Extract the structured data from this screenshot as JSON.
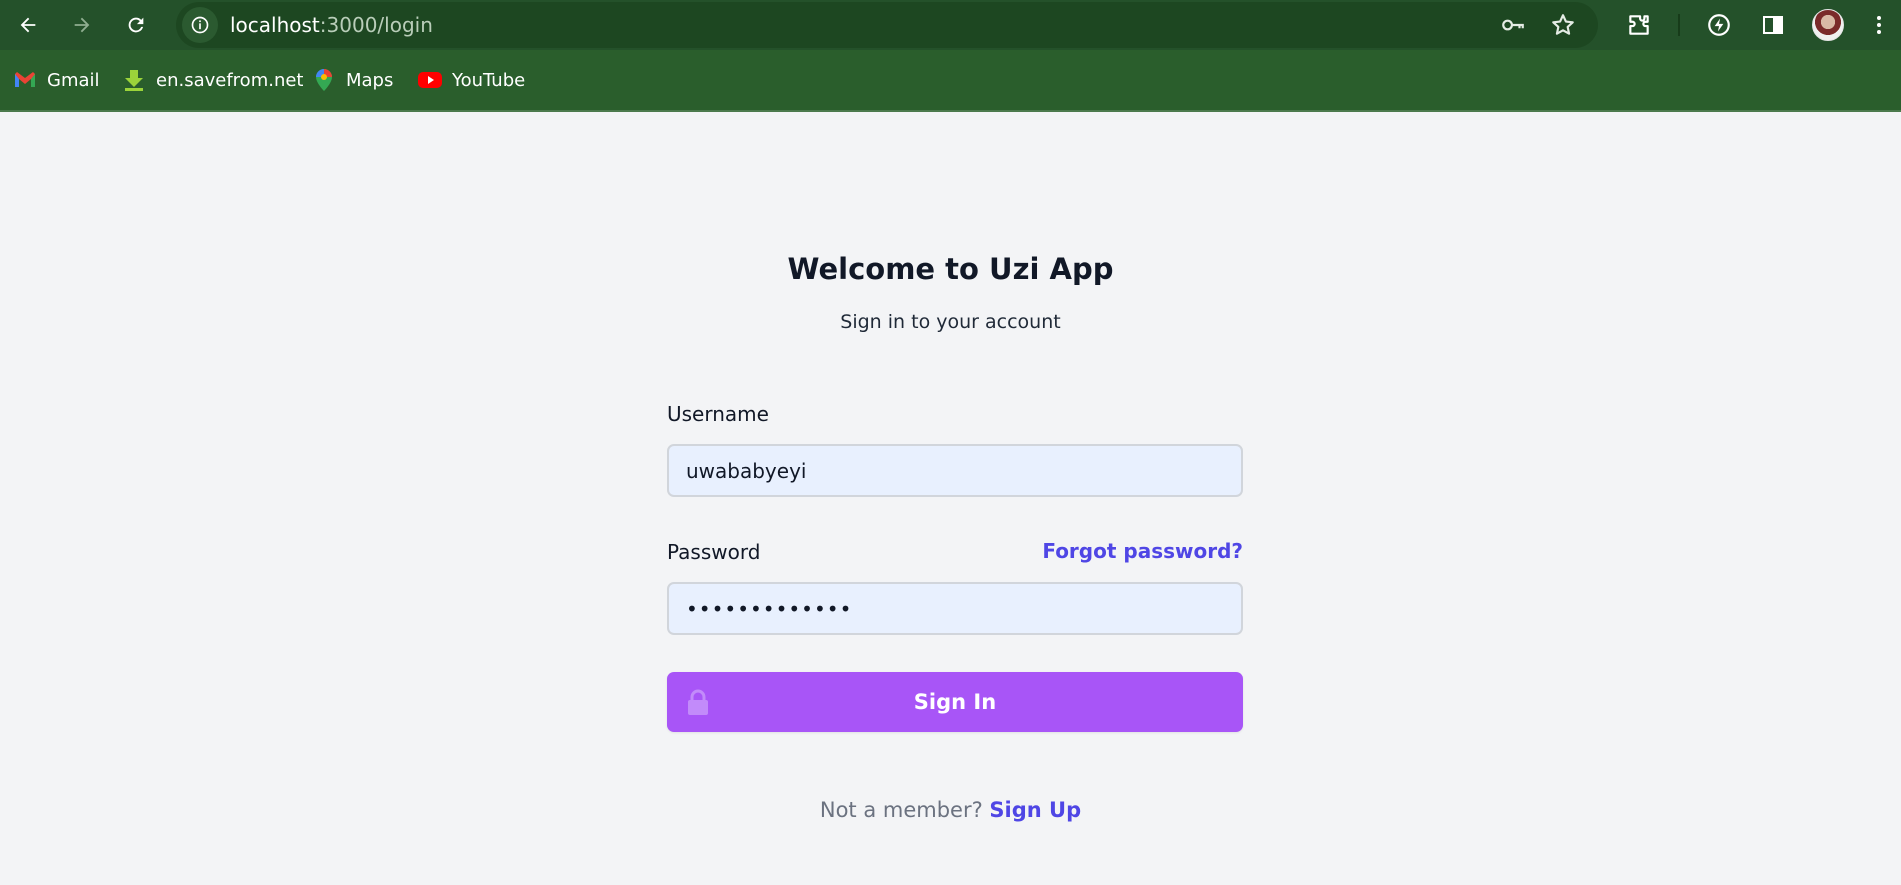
{
  "browser": {
    "url_host": "localhost",
    "url_path": ":3000/login",
    "bookmarks": [
      {
        "label": "Gmail",
        "icon": "gmail-icon"
      },
      {
        "label": "en.savefrom.net",
        "icon": "savefrom-icon"
      },
      {
        "label": "Maps",
        "icon": "maps-icon"
      },
      {
        "label": "YouTube",
        "icon": "youtube-icon"
      }
    ],
    "colors": {
      "chrome": "#2a5e2c",
      "toolbar": "#24512a",
      "omnibox": "#1d4721"
    }
  },
  "page": {
    "title": "Welcome to Uzi App",
    "subtitle": "Sign in to your account",
    "username_label": "Username",
    "username_value": "uwababyeyi",
    "password_label": "Password",
    "password_value": "•••••••••••••",
    "forgot_link": "Forgot password?",
    "signin_button": "Sign In",
    "footer_prompt": "Not a member?",
    "signup_link": "Sign Up",
    "colors": {
      "background": "#f3f4f6",
      "button": "#a855f7",
      "link": "#4f46e5",
      "input_bg": "#e8f0fe"
    }
  }
}
